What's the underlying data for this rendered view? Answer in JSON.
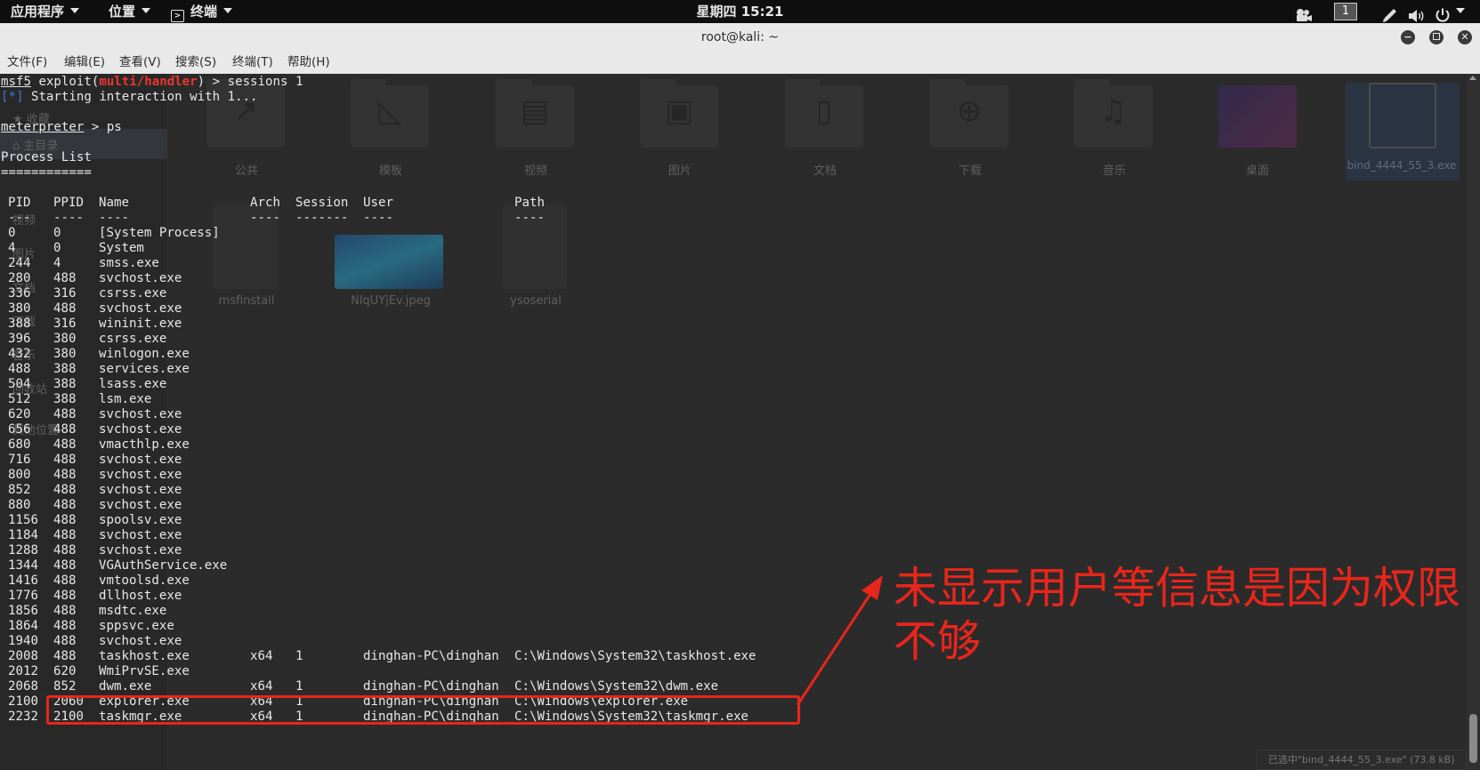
{
  "top_bar": {
    "applications_menu": "应用程序",
    "places_menu": "位置",
    "terminal_menu": "终端",
    "clock": "星期四 15:21",
    "workspace": "1"
  },
  "window": {
    "title": "root@kali: ~"
  },
  "menubar": {
    "items": [
      "文件(F)",
      "编辑(E)",
      "查看(V)",
      "搜索(S)",
      "终端(T)",
      "帮助(H)"
    ]
  },
  "background_file_manager": {
    "sidebar": [
      "收藏",
      "主目录",
      "视频",
      "图片",
      "文档",
      "下载",
      "音乐",
      "回收站",
      "其他位置"
    ],
    "folders": [
      "公共",
      "模板",
      "视频",
      "图片",
      "文档",
      "下载",
      "音乐",
      "桌面",
      "bind_4444_55_3.exe"
    ],
    "files": [
      "msfinstall",
      "NlqUYjEv.jpeg",
      "ysoserial"
    ],
    "status": "已选中\"bind_4444_55_3.exe\" (73.8 kB)"
  },
  "terminal": {
    "prompt_msf": "msf5",
    "prompt_exploit_prefix": " exploit(",
    "prompt_module": "multi/handler",
    "prompt_suffix": ") > ",
    "command_1": "sessions 1",
    "status_marker": "[*]",
    "status_text": " Starting interaction with 1...",
    "meterpreter_prompt": "meterpreter",
    "meterpreter_suffix": " > ",
    "command_2": "ps",
    "section_title": "Process List",
    "section_rule": "============",
    "columns": [
      "PID",
      "PPID",
      "Name",
      "Arch",
      "Session",
      "User",
      "Path"
    ],
    "column_rules": [
      "---",
      "----",
      "----",
      "----",
      "-------",
      "----",
      "----"
    ],
    "processes": [
      [
        "0",
        "0",
        "[System Process]",
        "",
        "",
        "",
        ""
      ],
      [
        "4",
        "0",
        "System",
        "",
        "",
        "",
        ""
      ],
      [
        "244",
        "4",
        "smss.exe",
        "",
        "",
        "",
        ""
      ],
      [
        "280",
        "488",
        "svchost.exe",
        "",
        "",
        "",
        ""
      ],
      [
        "336",
        "316",
        "csrss.exe",
        "",
        "",
        "",
        ""
      ],
      [
        "380",
        "488",
        "svchost.exe",
        "",
        "",
        "",
        ""
      ],
      [
        "388",
        "316",
        "wininit.exe",
        "",
        "",
        "",
        ""
      ],
      [
        "396",
        "380",
        "csrss.exe",
        "",
        "",
        "",
        ""
      ],
      [
        "432",
        "380",
        "winlogon.exe",
        "",
        "",
        "",
        ""
      ],
      [
        "488",
        "388",
        "services.exe",
        "",
        "",
        "",
        ""
      ],
      [
        "504",
        "388",
        "lsass.exe",
        "",
        "",
        "",
        ""
      ],
      [
        "512",
        "388",
        "lsm.exe",
        "",
        "",
        "",
        ""
      ],
      [
        "620",
        "488",
        "svchost.exe",
        "",
        "",
        "",
        ""
      ],
      [
        "656",
        "488",
        "svchost.exe",
        "",
        "",
        "",
        ""
      ],
      [
        "680",
        "488",
        "vmacthlp.exe",
        "",
        "",
        "",
        ""
      ],
      [
        "716",
        "488",
        "svchost.exe",
        "",
        "",
        "",
        ""
      ],
      [
        "800",
        "488",
        "svchost.exe",
        "",
        "",
        "",
        ""
      ],
      [
        "852",
        "488",
        "svchost.exe",
        "",
        "",
        "",
        ""
      ],
      [
        "880",
        "488",
        "svchost.exe",
        "",
        "",
        "",
        ""
      ],
      [
        "1156",
        "488",
        "spoolsv.exe",
        "",
        "",
        "",
        ""
      ],
      [
        "1184",
        "488",
        "svchost.exe",
        "",
        "",
        "",
        ""
      ],
      [
        "1288",
        "488",
        "svchost.exe",
        "",
        "",
        "",
        ""
      ],
      [
        "1344",
        "488",
        "VGAuthService.exe",
        "",
        "",
        "",
        ""
      ],
      [
        "1416",
        "488",
        "vmtoolsd.exe",
        "",
        "",
        "",
        ""
      ],
      [
        "1776",
        "488",
        "dllhost.exe",
        "",
        "",
        "",
        ""
      ],
      [
        "1856",
        "488",
        "msdtc.exe",
        "",
        "",
        "",
        ""
      ],
      [
        "1864",
        "488",
        "sppsvc.exe",
        "",
        "",
        "",
        ""
      ],
      [
        "1940",
        "488",
        "svchost.exe",
        "",
        "",
        "",
        ""
      ],
      [
        "2008",
        "488",
        "taskhost.exe",
        "x64",
        "1",
        "dinghan-PC\\dinghan",
        "C:\\Windows\\System32\\taskhost.exe"
      ],
      [
        "2012",
        "620",
        "WmiPrvSE.exe",
        "",
        "",
        "",
        ""
      ],
      [
        "2068",
        "852",
        "dwm.exe",
        "x64",
        "1",
        "dinghan-PC\\dinghan",
        "C:\\Windows\\System32\\dwm.exe"
      ],
      [
        "2100",
        "2060",
        "explorer.exe",
        "x64",
        "1",
        "dinghan-PC\\dinghan",
        "C:\\Windows\\explorer.exe"
      ],
      [
        "2232",
        "2100",
        "taskmgr.exe",
        "x64",
        "1",
        "dinghan-PC\\dinghan",
        "C:\\Windows\\System32\\taskmgr.exe"
      ]
    ]
  },
  "annotation": {
    "text": "未显示用户等信息是因为权限不够",
    "color": "#e8261b"
  }
}
